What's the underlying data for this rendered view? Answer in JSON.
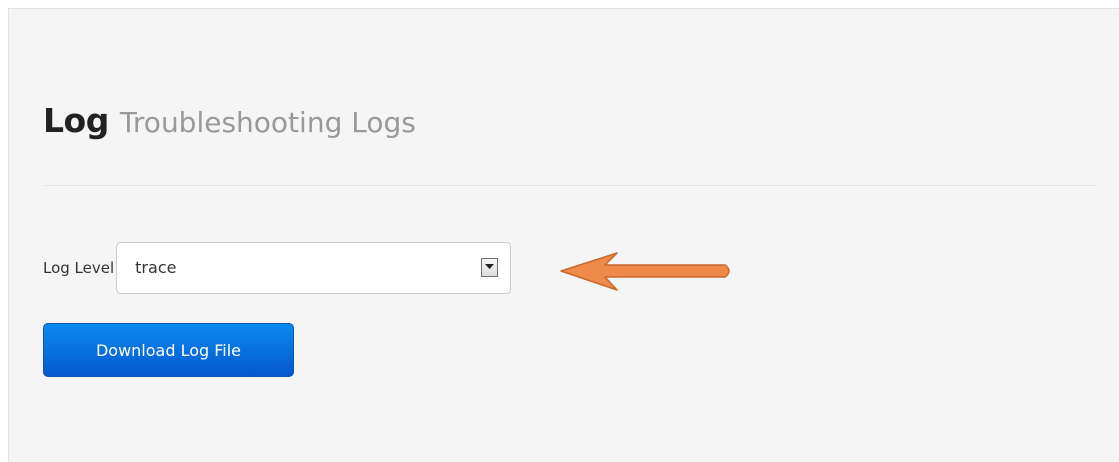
{
  "header": {
    "title": "Log",
    "subtitle": "Troubleshooting Logs"
  },
  "log_level": {
    "label": "Log Level",
    "selected": "trace"
  },
  "actions": {
    "download_label": "Download Log File"
  },
  "colors": {
    "panel_background": "#f5f5f5",
    "button_blue": "#0558cf",
    "annotation_arrow": "#f08a4b"
  },
  "icons": {
    "select_toggle": "chevron-down-icon",
    "annotation": "arrow-left-icon"
  }
}
